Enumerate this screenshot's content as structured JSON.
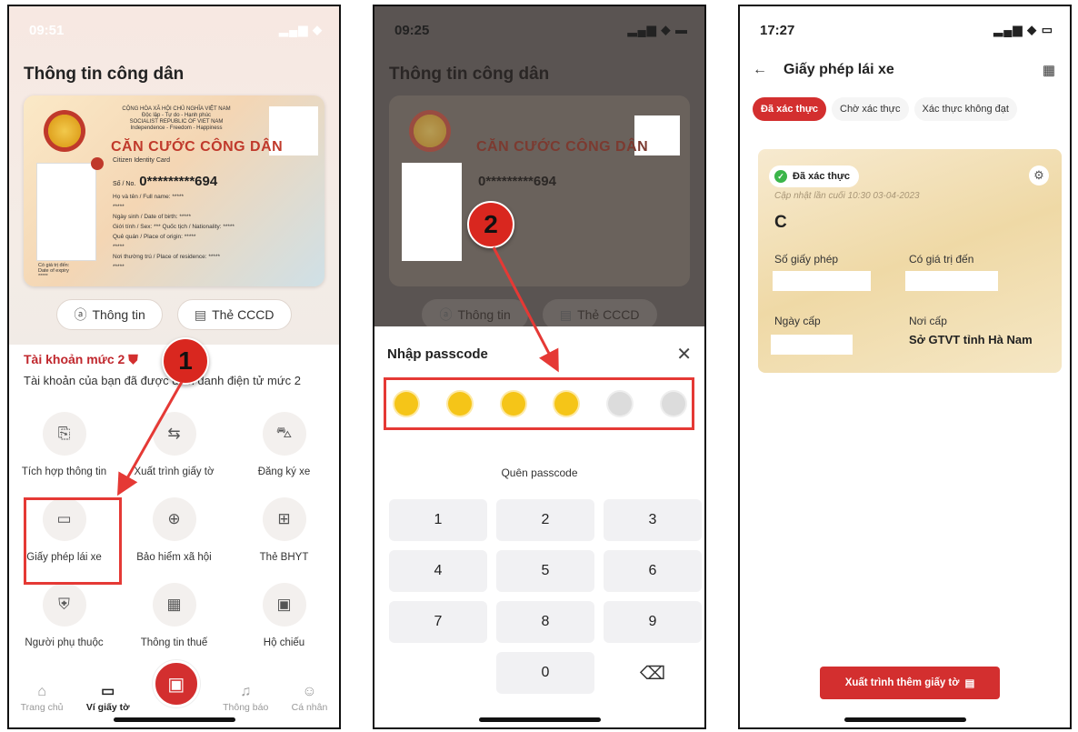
{
  "phone1": {
    "status_time": "09:51",
    "section_title": "Thông tin công dân",
    "card": {
      "header_line1": "CỘNG HÒA XÃ HỘI CHỦ NGHĨA VIỆT NAM",
      "header_line2": "Độc lập - Tự do - Hạnh phúc",
      "header_line3": "SOCIALIST REPUBLIC OF VIET NAM",
      "header_line4": "Independence - Freedom - Happiness",
      "title": "CĂN CƯỚC CÔNG DÂN",
      "subtitle": "Citizen Identity Card",
      "number_label": "Số / No.",
      "number": "0*********694",
      "line1": "Họ và tên / Full name: *****",
      "line2": "*****",
      "line3": "Ngày sinh / Date of birth: *****",
      "line4": "Giới tính / Sex: ***   Quốc tịch / Nationality: *****",
      "line5": "Quê quán / Place of origin: *****",
      "line6": "*****",
      "line7": "Nơi thường trú / Place of residence: *****",
      "line8": "*****",
      "footer1": "Có giá trị đến:",
      "footer2": "Date of expiry",
      "footer3": "*****"
    },
    "pills": [
      {
        "icon": "ⓐ",
        "label": "Thông tin"
      },
      {
        "icon": "▤",
        "label": "Thẻ CCCD"
      }
    ],
    "account_title": "Tài khoản mức 2",
    "account_desc": "Tài khoản của bạn đã được định danh điện tử mức 2",
    "services": [
      {
        "icon": "⎘",
        "label": "Tích hợp thông tin"
      },
      {
        "icon": "⇆",
        "label": "Xuất trình giấy tờ"
      },
      {
        "icon": "⛍",
        "label": "Đăng ký xe"
      },
      {
        "icon": "▭",
        "label": "Giấy phép lái xe"
      },
      {
        "icon": "⊕",
        "label": "Bảo hiểm xã hội"
      },
      {
        "icon": "⊞",
        "label": "Thẻ BHYT"
      },
      {
        "icon": "⛨",
        "label": "Người phụ thuộc"
      },
      {
        "icon": "▦",
        "label": "Thông tin thuế"
      },
      {
        "icon": "▣",
        "label": "Hộ chiếu"
      }
    ],
    "nav": [
      {
        "icon": "⌂",
        "label": "Trang chủ"
      },
      {
        "icon": "▭",
        "label": "Ví giấy tờ"
      },
      {
        "icon": "♫",
        "label": "Thông báo"
      },
      {
        "icon": "☺",
        "label": "Cá nhân"
      }
    ],
    "step": "1"
  },
  "phone2": {
    "status_time": "09:25",
    "section_title": "Thông tin công dân",
    "card_title": "CĂN CƯỚC CÔNG DÂN",
    "card_number": "0*********694",
    "pills": [
      {
        "icon": "ⓐ",
        "label": "Thông tin"
      },
      {
        "icon": "▤",
        "label": "Thẻ CCCD"
      }
    ],
    "sheet_title": "Nhập passcode",
    "close_icon": "✕",
    "passcode_filled": 4,
    "passcode_length": 6,
    "forgot": "Quên passcode",
    "keys": [
      "1",
      "2",
      "3",
      "4",
      "5",
      "6",
      "7",
      "8",
      "9",
      "",
      "0",
      "⌫"
    ],
    "step": "2"
  },
  "phone3": {
    "status_time": "17:27",
    "back_icon": "←",
    "title": "Giấy phép lái xe",
    "qr_icon": "▦",
    "tabs": [
      "Đã xác thực",
      "Chờ xác thực",
      "Xác thực không đạt"
    ],
    "badge": "Đã xác thực",
    "updated": "Cập nhật lần cuối 10:30 03-04-2023",
    "license_class": "C",
    "fields": {
      "license_no": "Số giấy phép",
      "valid_until": "Có giá trị đến",
      "issue_date": "Ngày cấp",
      "issue_place": "Nơi cấp",
      "issue_place_value": "Sở GTVT tỉnh Hà Nam"
    },
    "present_button": "Xuất trình thêm giấy tờ"
  },
  "colors": {
    "accent": "#d32f2f",
    "highlight": "#e53935",
    "passcode_on": "#f5c518",
    "verified": "#3bb54a"
  }
}
